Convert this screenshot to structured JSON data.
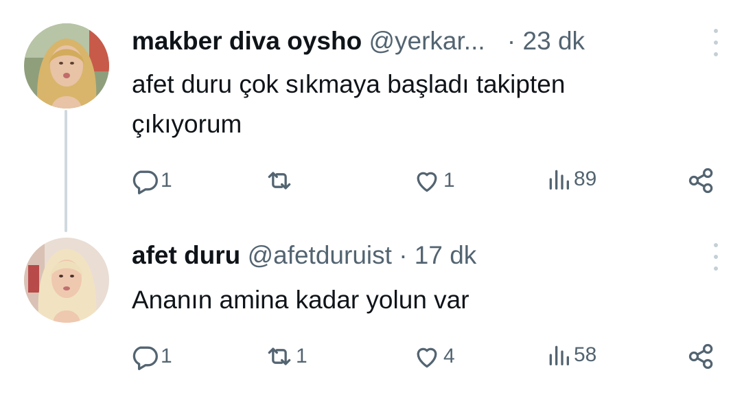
{
  "tweets": [
    {
      "author_name": "makber diva oysho",
      "handle": "@yerkar...",
      "separator": "·",
      "time": "23 dk",
      "text_line1": "afet duru çok sıkmaya başladı takipten",
      "text_line2": "çıkıyorum",
      "replies": "1",
      "retweets": "",
      "likes": "1",
      "views": "89"
    },
    {
      "author_name": "afet duru",
      "handle": "@afetduruist",
      "separator": "·",
      "time": "17 dk",
      "text_line1": "Ananın amina kadar yolun var",
      "replies": "1",
      "retweets": "1",
      "likes": "4",
      "views": "58"
    }
  ],
  "icons": {
    "reply": "reply-icon",
    "retweet": "retweet-icon",
    "like": "heart-icon",
    "views": "views-icon",
    "share": "share-icon",
    "more": "more-dots-icon"
  },
  "colors": {
    "text_primary": "#0f1419",
    "text_secondary": "#536471",
    "thread_line": "#cfd9de",
    "background": "#ffffff"
  }
}
